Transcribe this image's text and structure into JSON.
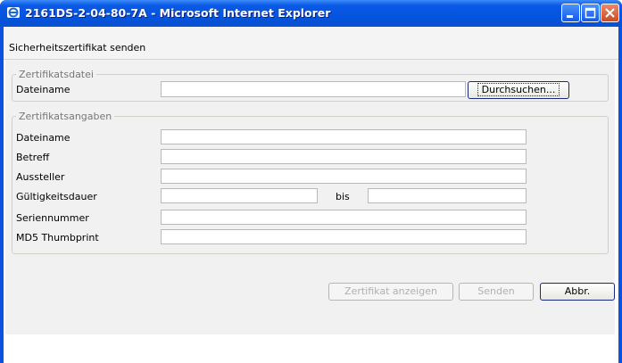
{
  "window": {
    "title": "2161DS-2-04-80-7A - Microsoft Internet Explorer"
  },
  "page": {
    "heading": "Sicherheitszertifikat senden"
  },
  "file_section": {
    "legend": "Zertifikatsdatei",
    "filename_label": "Dateiname",
    "filename_value": "",
    "browse_label": "Durchsuchen..."
  },
  "details_section": {
    "legend": "Zertifikatsangaben",
    "fields": [
      {
        "label": "Dateiname",
        "value": ""
      },
      {
        "label": "Betreff",
        "value": ""
      },
      {
        "label": "Aussteller",
        "value": ""
      },
      {
        "label": "Gültigkeitsdauer",
        "value": ""
      },
      {
        "label": "Seriennummer",
        "value": ""
      },
      {
        "label": "MD5 Thumbprint",
        "value": ""
      }
    ],
    "validity_to_label": "bis",
    "validity_to_value": ""
  },
  "actions": {
    "show_certificate": "Zertifikat anzeigen",
    "send": "Senden",
    "cancel": "Abbr."
  },
  "colors": {
    "titlebar": "#0a54e0",
    "panel": "#f1f1f1",
    "close_button": "#d14a1f"
  },
  "icons": [
    "ie-icon",
    "minimize-icon",
    "maximize-icon",
    "close-icon"
  ]
}
